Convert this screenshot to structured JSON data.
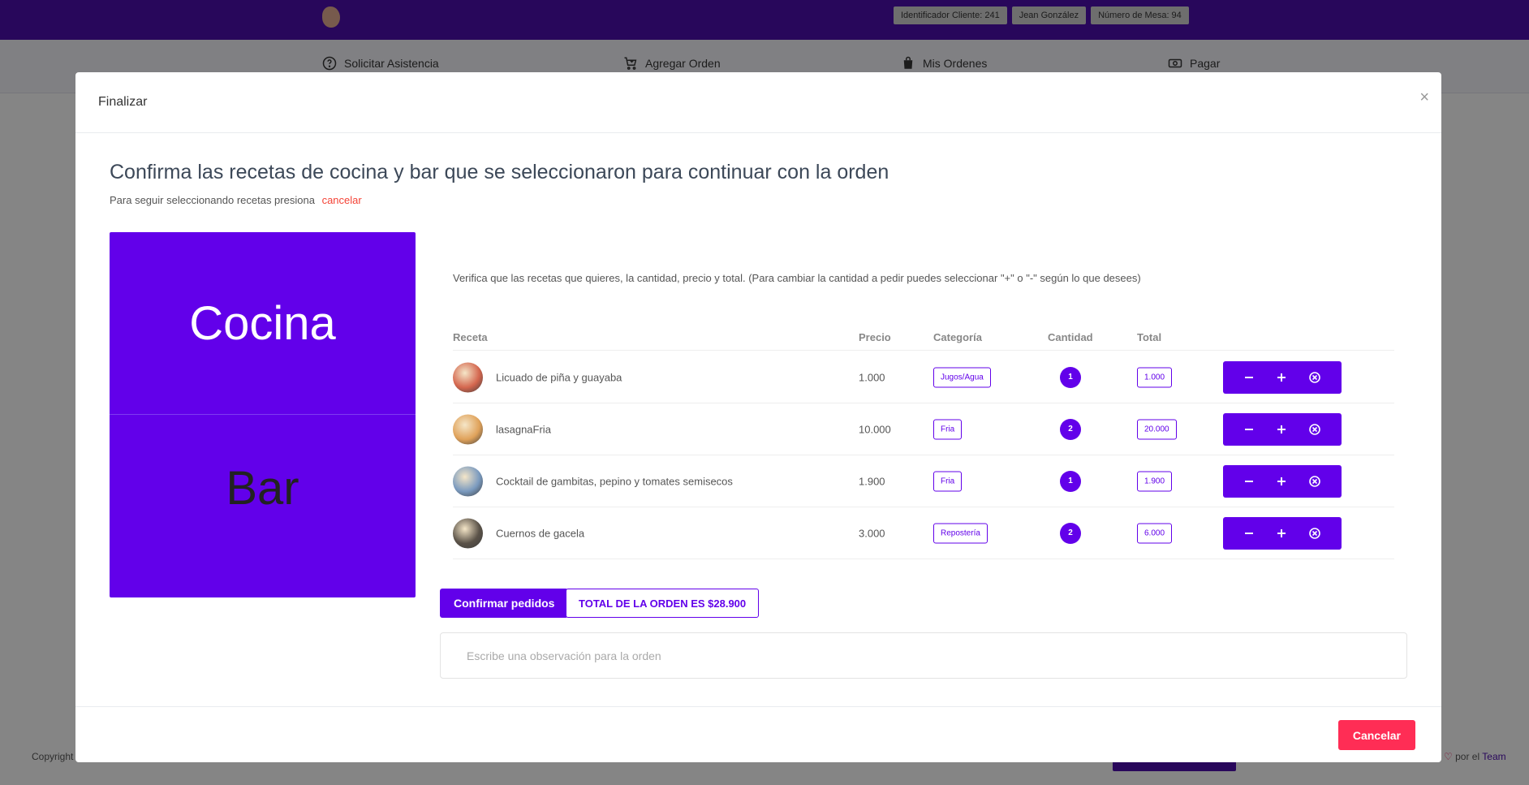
{
  "header": {
    "badges": {
      "client_id": "Identificador Cliente: 241",
      "user_name": "Jean González",
      "table_number": "Número de Mesa: 94"
    }
  },
  "nav": {
    "assistance": "Solicitar Asistencia",
    "add_order": "Agregar Orden",
    "my_orders": "Mis Ordenes",
    "pay": "Pagar"
  },
  "footer": {
    "copyright": "Copyright",
    "credit_prefix": "por el",
    "credit_team": "Team"
  },
  "modal": {
    "title": "Finalizar",
    "close": "×",
    "heading": "Confirma las recetas de cocina y bar que se seleccionaron para continuar con la orden",
    "subheading": "Para seguir seleccionando recetas presiona",
    "cancel_link": "cancelar",
    "categories": {
      "kitchen": "Cocina",
      "bar": "Bar"
    },
    "instructions": "Verifica que las recetas que quieres, la cantidad, precio y total. (Para cambiar la cantidad a pedir puedes seleccionar \"+\" o \"-\" según lo que desees)",
    "columns": {
      "recipe": "Receta",
      "price": "Precio",
      "category": "Categoría",
      "quantity": "Cantidad",
      "total": "Total"
    },
    "rows": [
      {
        "name": "Licuado de piña y guayaba",
        "price": "1.000",
        "category": "Jugos/Agua",
        "quantity": "1",
        "total": "1.000",
        "thumb_color": "#d4664e"
      },
      {
        "name": "lasagnaFria",
        "price": "10.000",
        "category": "Fria",
        "quantity": "2",
        "total": "20.000",
        "thumb_color": "#e0a25a"
      },
      {
        "name": "Cocktail de gambitas, pepino y tomates semisecos",
        "price": "1.900",
        "category": "Fria",
        "quantity": "1",
        "total": "1.900",
        "thumb_color": "#7a9abf"
      },
      {
        "name": "Cuernos de gacela",
        "price": "3.000",
        "category": "Repostería",
        "quantity": "2",
        "total": "6.000",
        "thumb_color": "#5a5248"
      }
    ],
    "action_icons": [
      "minus-icon",
      "plus-icon",
      "remove-circle-icon"
    ],
    "confirm_button": "Confirmar pedidos",
    "order_total": "TOTAL DE LA ORDEN ES $28.900",
    "observation_placeholder": "Escribe una observación para la orden",
    "cancel_button": "Cancelar"
  },
  "colors": {
    "brand": "#4a0ea6",
    "accent": "#6200ea",
    "danger": "#ff2d55"
  }
}
